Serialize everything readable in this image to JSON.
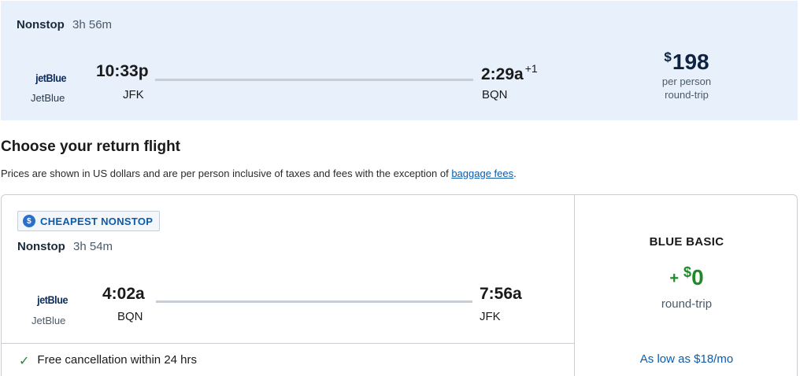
{
  "selected_flight": {
    "stops": "Nonstop",
    "duration": "3h 56m",
    "airline_logo": "jetBlue",
    "airline_name": "JetBlue",
    "depart_time": "10:33p",
    "depart_code": "JFK",
    "arrive_time": "2:29a",
    "arrive_day_offset": "+1",
    "arrive_code": "BQN",
    "price_currency": "$",
    "price_amount": "198",
    "price_line1": "per person",
    "price_line2": "round-trip"
  },
  "heading": {
    "title": "Choose your return flight",
    "disclaimer_text": "Prices are shown in US dollars and are per person inclusive of taxes and fees with the exception of ",
    "disclaimer_link": "baggage fees",
    "disclaimer_end": "."
  },
  "return_flight": {
    "badge_label": "CHEAPEST NONSTOP",
    "badge_icon": "dollar-icon",
    "stops": "Nonstop",
    "duration": "3h 54m",
    "airline_logo": "jetBlue",
    "airline_name": "JetBlue",
    "depart_time": "4:02a",
    "depart_code": "BQN",
    "arrive_time": "7:56a",
    "arrive_code": "JFK",
    "cancellation_text": "Free cancellation within 24 hrs",
    "fare_name": "BLUE BASIC",
    "fare_plus": "+",
    "fare_currency": "$",
    "fare_amount": "0",
    "fare_sub": "round-trip",
    "fare_monthly": "As low as $18/mo"
  },
  "colors": {
    "selected_bg": "#e7f0fb",
    "link": "#0b5cad",
    "fare_green": "#1f8a2a"
  }
}
